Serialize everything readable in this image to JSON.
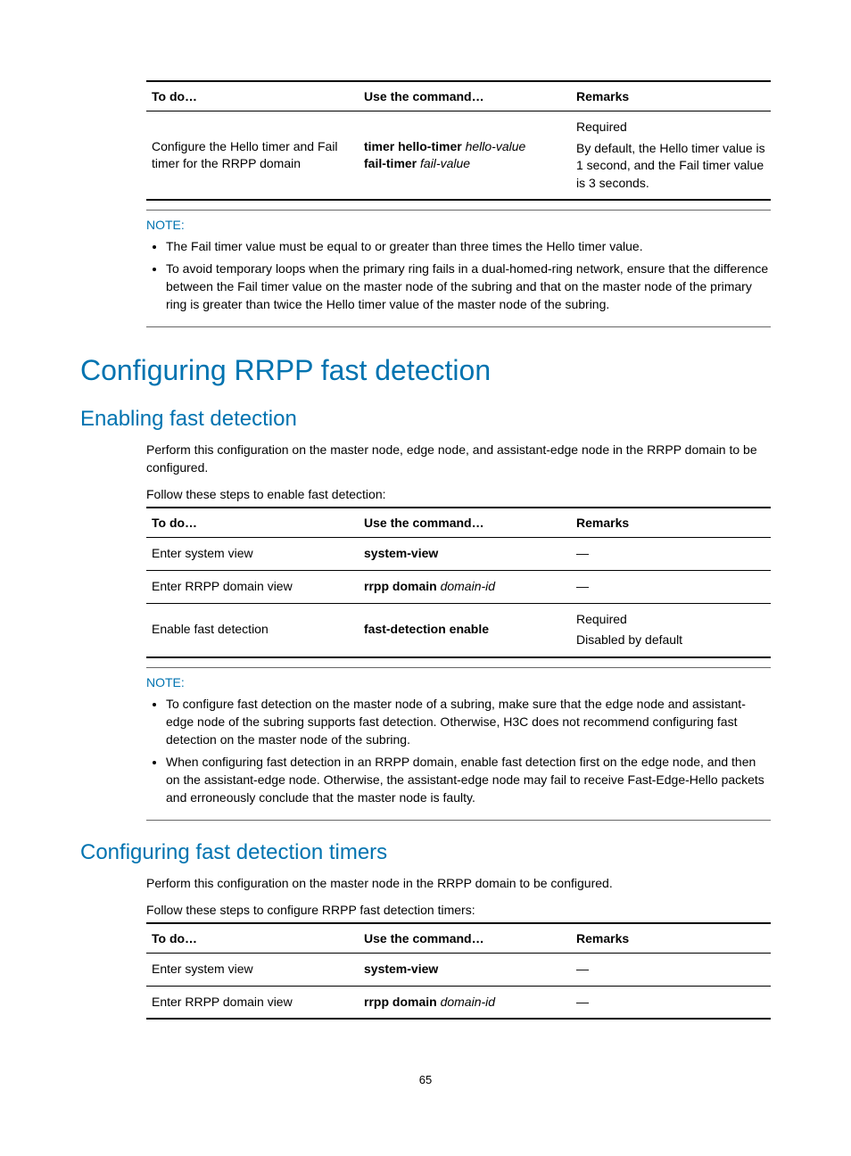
{
  "table1": {
    "headers": [
      "To do…",
      "Use the command…",
      "Remarks"
    ],
    "row": {
      "todo": "Configure the Hello timer and Fail timer for the RRPP domain",
      "cmd_bold1": "timer hello-timer",
      "cmd_ital1": "hello-value",
      "cmd_bold2": "fail-timer",
      "cmd_ital2": "fail-value",
      "rem_line1": "Required",
      "rem_line2": "By default, the Hello timer value is 1 second, and the Fail timer value is 3 seconds."
    }
  },
  "note1": {
    "label": "NOTE:",
    "items": [
      "The Fail timer value must be equal to or greater than three times the Hello timer value.",
      "To avoid temporary loops when the primary ring fails in a dual-homed-ring network, ensure that the difference between the Fail timer value on the master node of the subring and that on the master node of the primary ring is greater than twice the Hello timer value of the master node of the subring."
    ]
  },
  "h1": "Configuring RRPP fast detection",
  "h2a": "Enabling fast detection",
  "p1": "Perform this configuration on the master node, edge node, and assistant-edge node in the RRPP domain to be configured.",
  "caption2": "Follow these steps to enable fast detection:",
  "table2": {
    "headers": [
      "To do…",
      "Use the command…",
      "Remarks"
    ],
    "rows": [
      {
        "todo": "Enter system view",
        "cmd_bold": "system-view",
        "cmd_ital": "",
        "rem": "—"
      },
      {
        "todo": "Enter RRPP domain view",
        "cmd_bold": "rrpp domain",
        "cmd_ital": "domain-id",
        "rem": "—"
      },
      {
        "todo": "Enable fast detection",
        "cmd_bold": "fast-detection enable",
        "cmd_ital": "",
        "rem_line1": "Required",
        "rem_line2": "Disabled by default"
      }
    ]
  },
  "note2": {
    "label": "NOTE:",
    "items": [
      "To configure fast detection on the master node of a subring, make sure that the edge node and assistant-edge node of the subring supports fast detection. Otherwise, H3C does not recommend configuring fast detection on the master node of the subring.",
      "When configuring fast detection in an RRPP domain, enable fast detection first on the edge node, and then on the assistant-edge node. Otherwise, the assistant-edge node may fail to receive Fast-Edge-Hello packets and erroneously conclude that the master node is faulty."
    ]
  },
  "h2b": "Configuring fast detection timers",
  "p2": "Perform this configuration on the master node in the RRPP domain to be configured.",
  "caption3": "Follow these steps to configure RRPP fast detection timers:",
  "table3": {
    "headers": [
      "To do…",
      "Use the command…",
      "Remarks"
    ],
    "rows": [
      {
        "todo": "Enter system view",
        "cmd_bold": "system-view",
        "cmd_ital": "",
        "rem": "—"
      },
      {
        "todo": "Enter RRPP domain view",
        "cmd_bold": "rrpp domain",
        "cmd_ital": "domain-id",
        "rem": "—"
      }
    ]
  },
  "page_number": "65"
}
